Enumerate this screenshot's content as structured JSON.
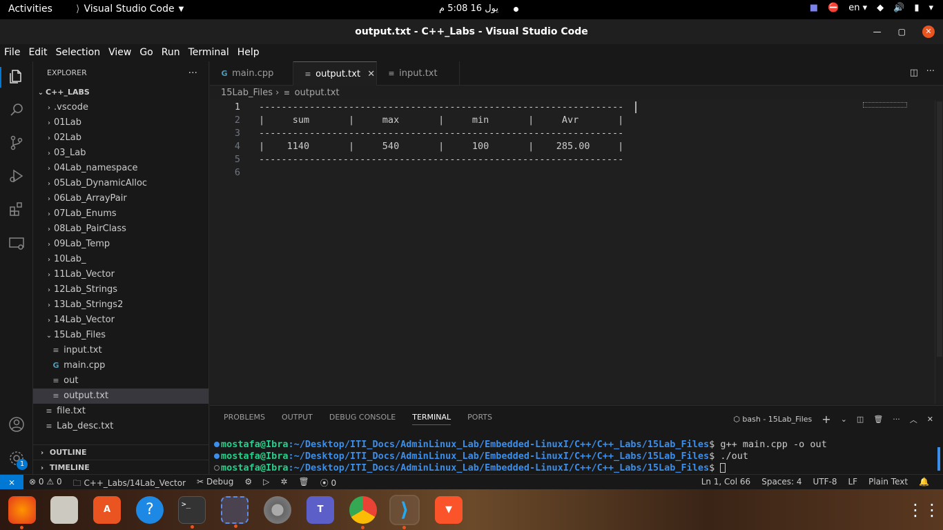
{
  "topbar": {
    "activities": "Activities",
    "app_name": "Visual Studio Code",
    "clock": "يول 16  5:08 م",
    "lang": "en"
  },
  "window": {
    "title": "output.txt - C++_Labs - Visual Studio Code"
  },
  "menu": [
    "File",
    "Edit",
    "Selection",
    "View",
    "Go",
    "Run",
    "Terminal",
    "Help"
  ],
  "sidebar": {
    "title": "EXPLORER",
    "root": "C++_LABS",
    "folders": [
      ".vscode",
      "01Lab",
      "02Lab",
      "03_Lab",
      "04Lab_namespace",
      "05Lab_DynamicAlloc",
      "06Lab_ArrayPair",
      "07Lab_Enums",
      "08Lab_PairClass",
      "09Lab_Temp",
      "10Lab_",
      "11Lab_Vector",
      "12Lab_Strings",
      "13Lab_Strings2",
      "14Lab_Vector"
    ],
    "open_folder": "15Lab_Files",
    "open_folder_files": [
      "input.txt",
      "main.cpp",
      "out",
      "output.txt"
    ],
    "root_files": [
      "file.txt",
      "Lab_desc.txt"
    ],
    "outline": "OUTLINE",
    "timeline": "TIMELINE"
  },
  "tabs": [
    "main.cpp",
    "output.txt",
    "input.txt"
  ],
  "breadcrumb": [
    "15Lab_Files",
    "output.txt"
  ],
  "editor": {
    "lines": [
      "-----------------------------------------------------------------",
      "|     sum       |     max       |     min       |     Avr       |",
      "-----------------------------------------------------------------",
      "|    1140       |     540       |     100       |    285.00     |",
      "-----------------------------------------------------------------",
      ""
    ]
  },
  "panel": {
    "tabs": [
      "PROBLEMS",
      "OUTPUT",
      "DEBUG CONSOLE",
      "TERMINAL",
      "PORTS"
    ],
    "terminal_name": "bash - 15Lab_Files",
    "user": "mostafa@Ibra",
    "path": ":~/Desktop/ITI_Docs/AdminLinux_Lab/Embedded-LinuxI/C++/C++_Labs/15Lab_Files",
    "commands": [
      "g++ main.cpp -o out",
      "./out",
      ""
    ]
  },
  "status": {
    "errors": "0",
    "warnings": "0",
    "branch": "C++_Labs/14Lab_Vector",
    "debug": "Debug",
    "ports": "0",
    "position": "Ln 1, Col 66",
    "spaces": "Spaces: 4",
    "encoding": "UTF-8",
    "eol": "LF",
    "language": "Plain Text"
  },
  "colors": {
    "accent": "#0078d4",
    "terminal_user": "#23d18b",
    "terminal_path": "#3b8eea"
  }
}
